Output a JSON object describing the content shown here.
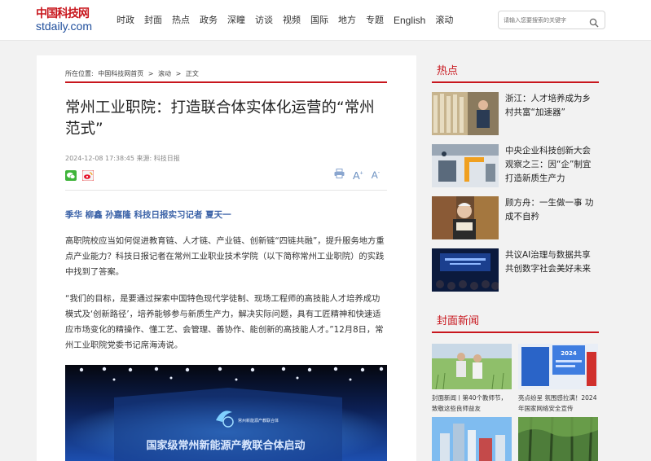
{
  "header": {
    "logo_cn": "中国科技网",
    "logo_en": "stdaily.com",
    "nav": [
      "时政",
      "封面",
      "热点",
      "政务",
      "深瞳",
      "访谈",
      "视频",
      "国际",
      "地方",
      "专题",
      "English",
      "滚动"
    ],
    "search_placeholder": "请输入您要搜索的关键字"
  },
  "article": {
    "breadcrumb": {
      "label": "所在位置:",
      "home": "中国科技网首页",
      "sep1": ">",
      "section": "滚动",
      "sep2": ">",
      "current": "正文"
    },
    "title": "常州工业职院：打造联合体实体化运营的“常州范式”",
    "meta": "2024-12-08 17:38:45 来源: 科技日报",
    "tools": {
      "print": "print-icon",
      "font_up": "A⁺",
      "font_down": "A⁻"
    },
    "authors": "季华 柳鑫 孙嘉隆 科技日报实习记者 夏天一",
    "paragraphs": [
      "高职院校应当如何促进教育链、人才链、产业链、创新链“四链共融”，提升服务地方重点产业能力？科技日报记者在常州工业职业技术学院（以下简称常州工业职院）的实践中找到了答案。",
      "“我们的目标，是要通过探索中国特色现代学徒制、现场工程师的高技能人才培养成功模式及‘创新路径’，培养能够参与新质生产力，解决实际问题，具有工匠精神和快速适应市场变化的精操作、懂工艺、会管理、善协作、能创新的高技能人才。”12月8日，常州工业职院党委书记席海涛说。"
    ],
    "photo_banner": "国家级常州新能源产教联合体启动",
    "photo_logo": "常州新能源产教联合体"
  },
  "sidebar": {
    "hot_title": "热点",
    "hot_items": [
      "浙江：人才培养成为乡村共富“加速器”",
      "中央企业科技创新大会观察之三：因“企”制宜打造新质生产力",
      "顾方舟：一生做一事 功成不自矜",
      "共议AI治理与数据共享 共创数字社会美好未来"
    ],
    "cover_title": "封面新闻",
    "cover_items": [
      "封面新闻丨第40个教师节，致敬这些良师益友",
      "亮点纷呈 氛围感拉满！2024年国家网络安全宣传",
      "",
      ""
    ],
    "cover_badge": "2024"
  },
  "colors": {
    "accent": "#c8161d",
    "link_blue": "#3c63a8",
    "logo_blue": "#1f4e9c"
  }
}
